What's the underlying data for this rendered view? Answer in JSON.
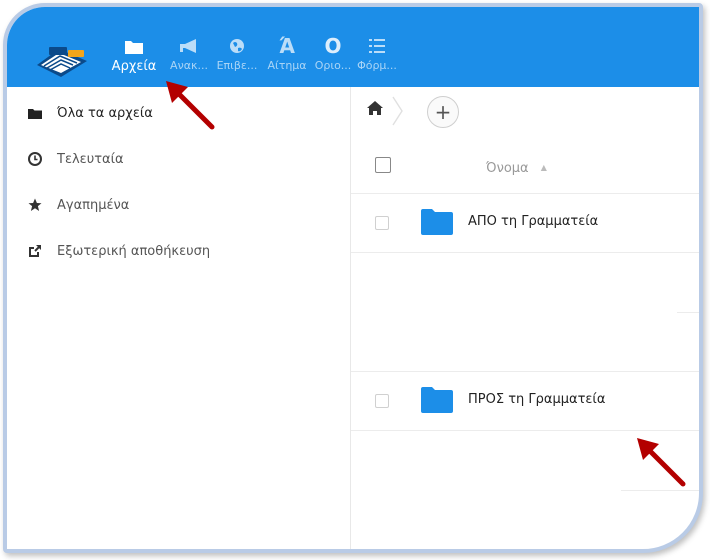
{
  "topbar": {
    "apps": [
      {
        "label": "Αρχεία",
        "icon": "folder-icon",
        "active": true
      },
      {
        "label": "Ανακ...",
        "icon": "megaphone-icon",
        "active": false
      },
      {
        "label": "Επιβε...",
        "icon": "globe-icon",
        "active": false
      },
      {
        "label": "Αίτημα",
        "icon": "text-a-icon",
        "active": false
      },
      {
        "label": "Οριο...",
        "icon": "circle-o-icon",
        "active": false
      },
      {
        "label": "Φόρμ...",
        "icon": "list-icon",
        "active": false
      }
    ]
  },
  "sidebar": {
    "items": [
      {
        "label": "Όλα τα αρχεία",
        "icon": "folder-icon",
        "active": true
      },
      {
        "label": "Τελευταία",
        "icon": "clock-icon",
        "active": false
      },
      {
        "label": "Αγαπημένα",
        "icon": "star-icon",
        "active": false
      },
      {
        "label": "Εξωτερική αποθήκευση",
        "icon": "external-link-icon",
        "active": false
      }
    ]
  },
  "files": {
    "column_name": "Όνομα",
    "sort_indicator": "▲",
    "rows": [
      {
        "name": "ΑΠΟ τη Γραμματεία",
        "type": "folder"
      },
      {
        "name": "ΠΡΟΣ τη Γραμματεία",
        "type": "folder"
      }
    ]
  },
  "breadcrumb": {
    "add_label": "+"
  },
  "colors": {
    "accent": "#1c8ee8",
    "folder": "#1c8ee8",
    "annotation_arrow": "#b30000"
  }
}
